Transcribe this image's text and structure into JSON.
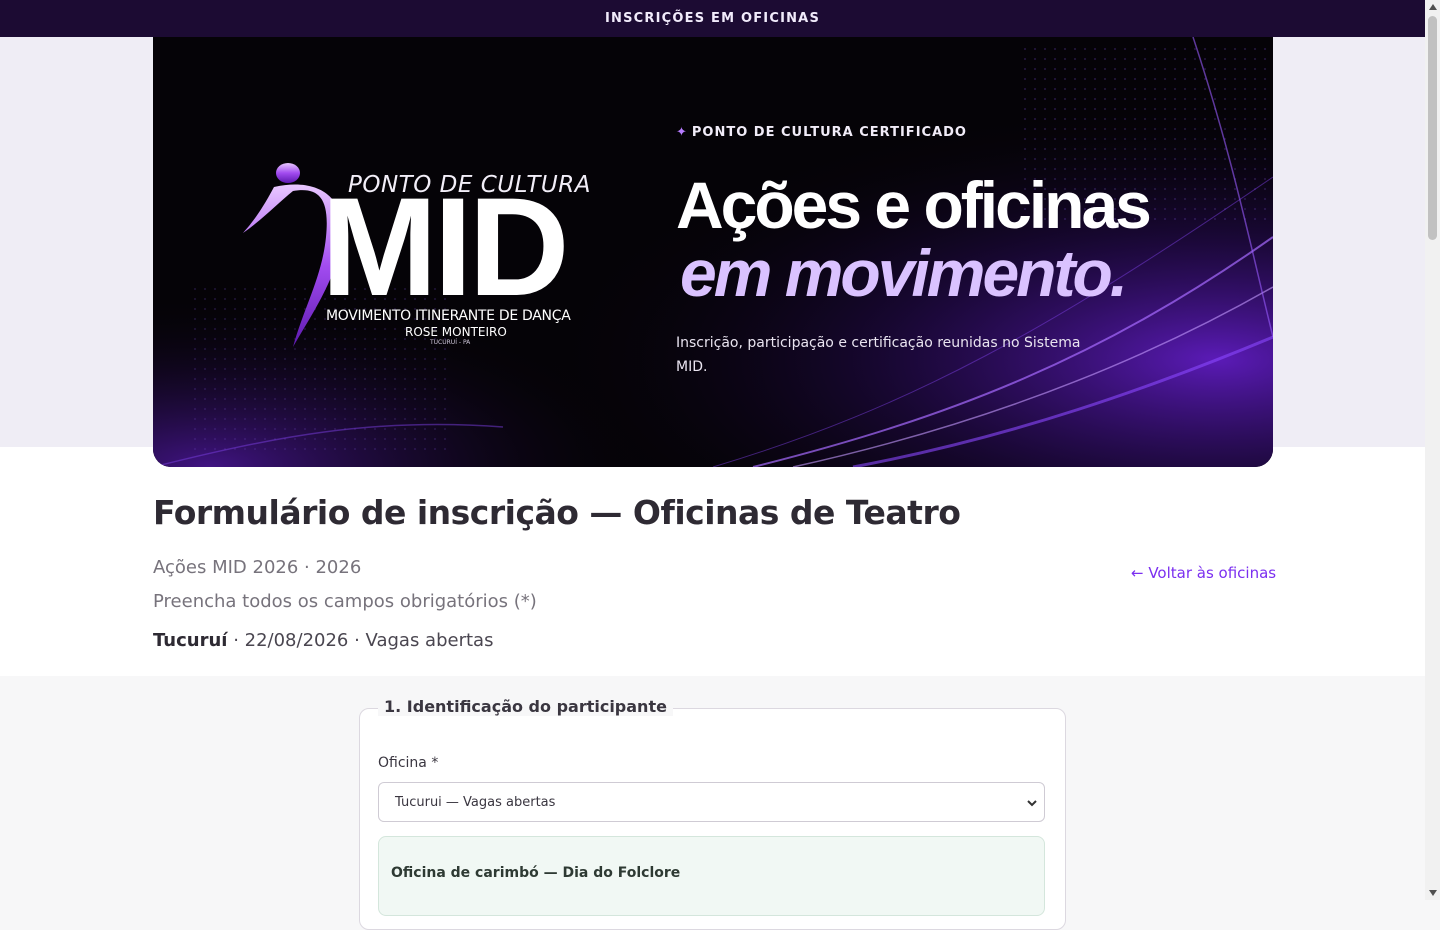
{
  "topbar": {
    "title": "INSCRIÇÕES EM OFICINAS"
  },
  "banner": {
    "logo": {
      "top": "PONTO DE CULTURA",
      "big": "MID",
      "line1": "MOVIMENTO ITINERANTE DE DANÇA",
      "line2": "ROSE MONTEIRO",
      "line3": "TUCURUÍ - PA"
    },
    "kicker": "PONTO DE CULTURA CERTIFICADO",
    "headline_1": "Ações e oficinas",
    "headline_2": "em movimento.",
    "blurb": "Inscrição, participação e certificação reunidas no Sistema MID."
  },
  "header": {
    "title": "Formulário de inscrição — Oficinas de Teatro",
    "subtitle": "Ações MID 2026 · 2026",
    "instructions": "Preencha todos os campos obrigatórios (*)",
    "city": "Tucuruí",
    "details": " · 22/08/2026 · Vagas abertas",
    "back_link": "← Voltar às oficinas"
  },
  "form": {
    "section_title": "1. Identificação do participante",
    "oficina_label": "Oficina *",
    "oficina_selected": "Tucurui — Vagas abertas",
    "info_title": "Oficina de carimbó — Dia do Folclore"
  },
  "colors": {
    "topbar": "#1c0b33",
    "accent": "#7b2ff0",
    "headline_2": "#dac2ff"
  }
}
